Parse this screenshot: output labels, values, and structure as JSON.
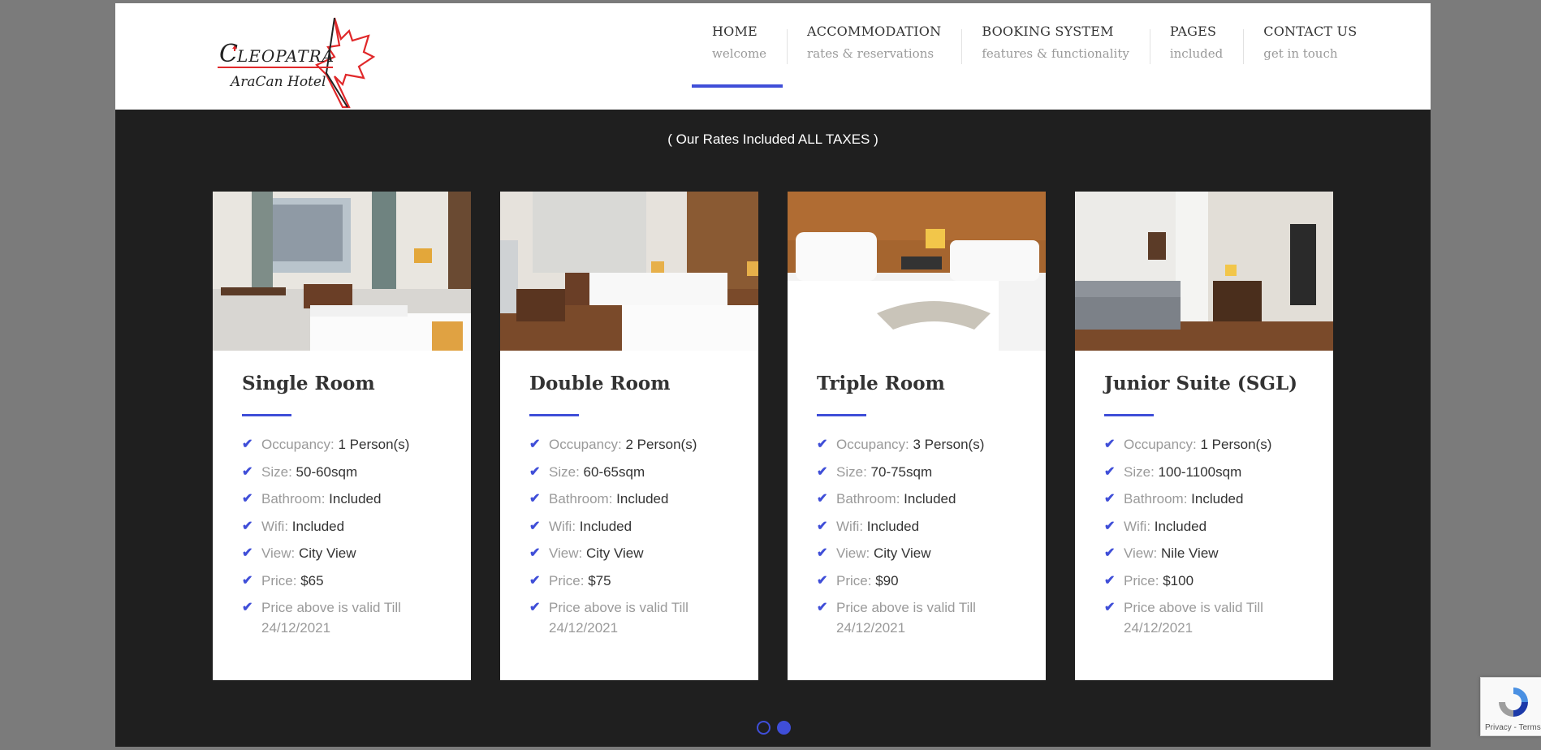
{
  "brand": {
    "logo_name": "Cleopatra",
    "logo_sub": "AraCan Hotel",
    "accent_color": "#3f4ed8"
  },
  "nav": [
    {
      "title": "HOME",
      "sub": "welcome",
      "active": true
    },
    {
      "title": "ACCOMMODATION",
      "sub": "rates & reservations"
    },
    {
      "title": "BOOKING SYSTEM",
      "sub": "features & functionality"
    },
    {
      "title": "PAGES",
      "sub": "included"
    },
    {
      "title": "CONTACT US",
      "sub": "get in touch"
    }
  ],
  "tax_note": "( Our Rates Included ALL TAXES )",
  "labels": {
    "occupancy": "Occupancy:",
    "size": "Size:",
    "bathroom": "Bathroom:",
    "wifi": "Wifi:",
    "view": "View:",
    "price": "Price:",
    "validity": "Price above is valid Till 24/12/2021"
  },
  "rooms": [
    {
      "title": "Single Room",
      "occupancy": "1 Person(s)",
      "size": "50-60sqm",
      "bathroom": "Included",
      "wifi": "Included",
      "view": "City View",
      "price": "$65"
    },
    {
      "title": "Double Room",
      "occupancy": "2 Person(s)",
      "size": "60-65sqm",
      "bathroom": "Included",
      "wifi": "Included",
      "view": "City View",
      "price": "$75"
    },
    {
      "title": "Triple Room",
      "occupancy": "3 Person(s)",
      "size": "70-75sqm",
      "bathroom": "Included",
      "wifi": "Included",
      "view": "City View",
      "price": "$90"
    },
    {
      "title": "Junior Suite (SGL)",
      "occupancy": "1 Person(s)",
      "size": "100-1100sqm",
      "bathroom": "Included",
      "wifi": "Included",
      "view": "Nile View",
      "price": "$100"
    }
  ],
  "carousel": {
    "pages": 2,
    "current": 2
  },
  "recaptcha": {
    "text": "Privacy - Terms"
  }
}
